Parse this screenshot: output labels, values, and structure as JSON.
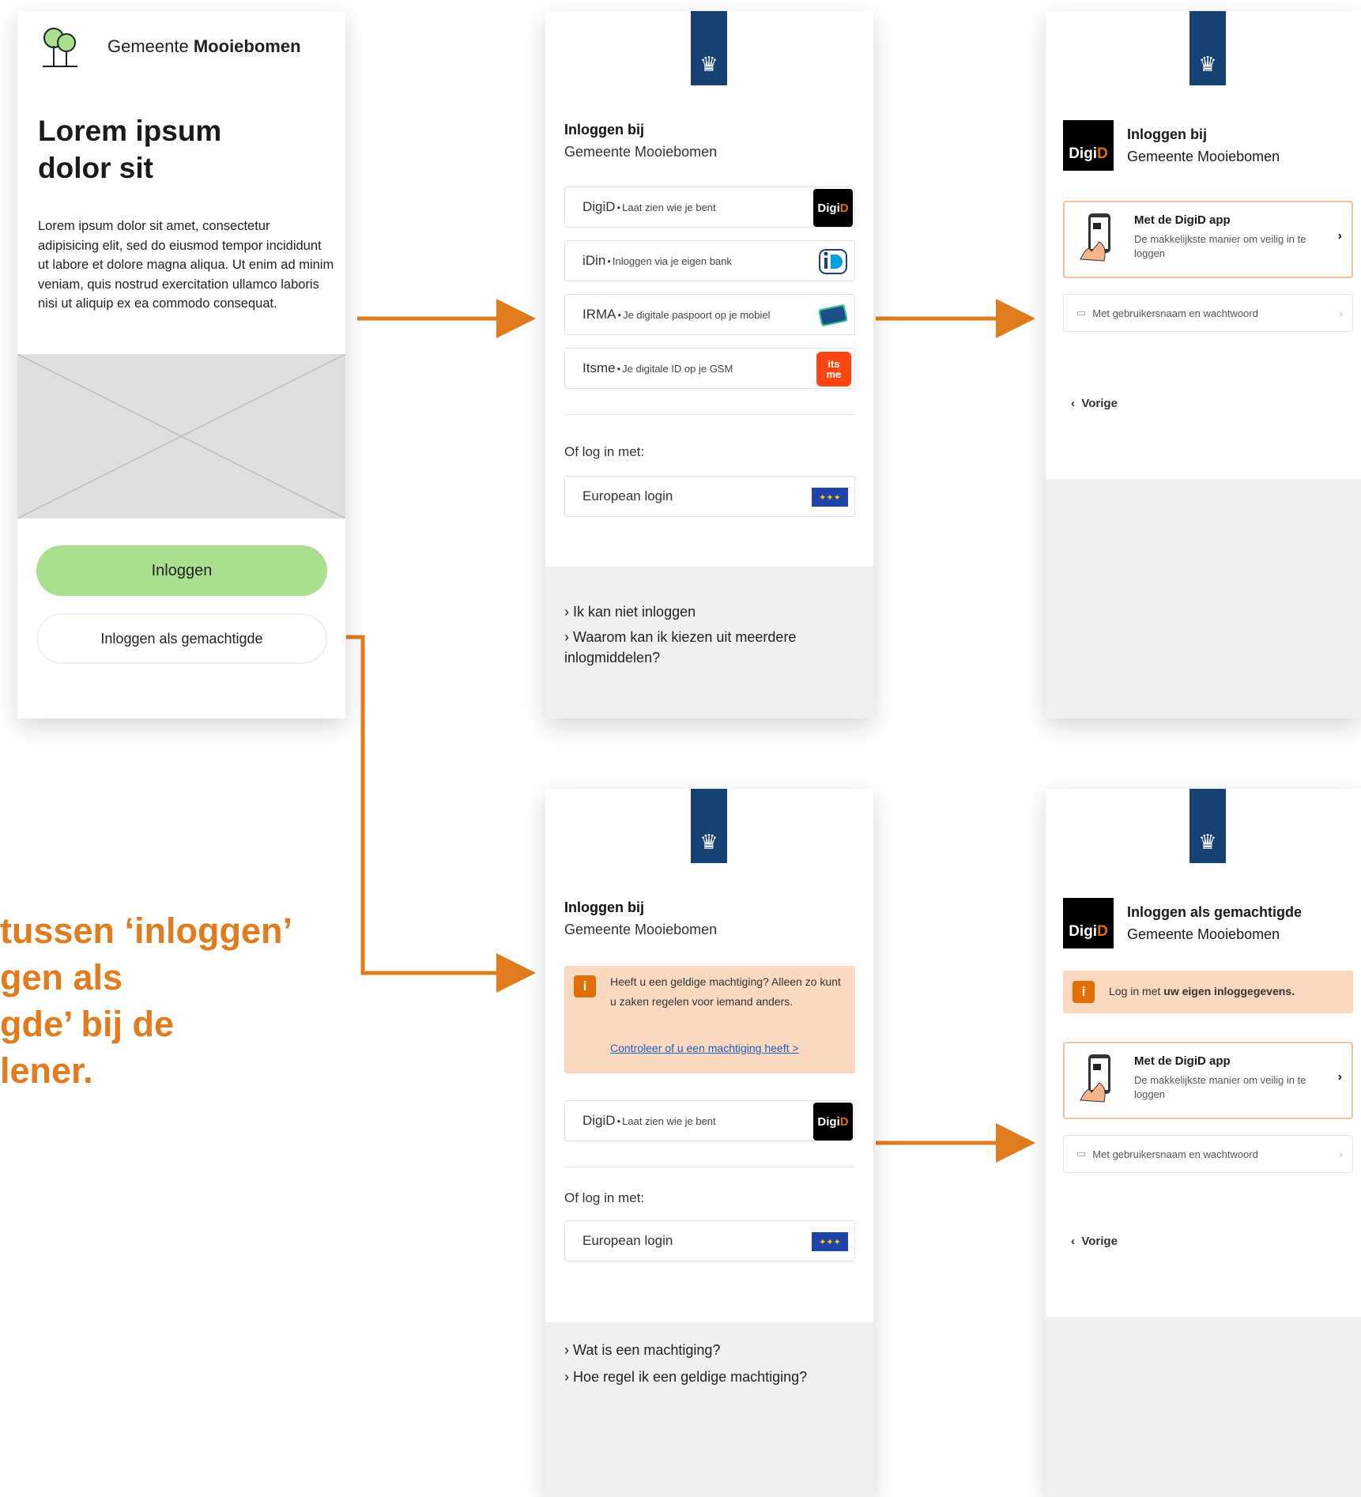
{
  "screen_gemeente": {
    "brand_prefix": "Gemeente",
    "brand_name": "Mooiebomen",
    "title": "Lorem ipsum dolor sit",
    "body": "Lorem ipsum dolor sit amet, consectetur adipisicing elit, sed do eiusmod tempor incididunt ut labore et dolore magna aliqua. Ut enim ad minim veniam, quis nostrud exercitation ullamco laboris nisi ut aliquip ex ea commodo consequat.",
    "btn_login": "Inloggen",
    "btn_gemachtigde": "Inloggen als gemachtigde"
  },
  "screen_login": {
    "title": "Inloggen bij",
    "subtitle": "Gemeente Mooiebomen",
    "options": [
      {
        "name": "DigiD",
        "desc": "Laat zien wie je bent",
        "logo": "DigiD"
      },
      {
        "name": "iDin",
        "desc": "Inloggen via je eigen bank",
        "logo": "iD"
      },
      {
        "name": "IRMA",
        "desc": "Je digitale paspoort op je mobiel",
        "logo": "IRMA"
      },
      {
        "name": "Itsme",
        "desc": "Je digitale ID op je GSM",
        "logo": "its me"
      }
    ],
    "or_label": "Of log in met:",
    "european": "European login",
    "faq": [
      "Ik kan niet inloggen",
      "Waarom kan ik kiezen uit meerdere inlogmiddelen?"
    ]
  },
  "screen_digid": {
    "title": "Inloggen bij",
    "subtitle": "Gemeente Mooiebomen",
    "app_title": "Met de DigiD app",
    "app_sub": "De makkelijkste manier om veilig in te loggen",
    "pw": "Met gebruikersnaam en wachtwoord",
    "back": "Vorige"
  },
  "screen_machtiging": {
    "title": "Inloggen bij",
    "subtitle": "Gemeente Mooiebomen",
    "notice": "Heeft u een geldige machtiging? Alleen zo kunt u zaken regelen voor iemand anders.",
    "notice_link": "Controleer of u een machtiging heeft >",
    "option": {
      "name": "DigiD",
      "desc": "Laat zien wie je bent"
    },
    "or_label": "Of log in met:",
    "european": "European login",
    "faq": [
      "Wat is een machtiging?",
      "Hoe regel ik een geldige machtiging?"
    ]
  },
  "screen_digid_gemachtigde": {
    "title": "Inloggen als gemachtigde",
    "subtitle": "Gemeente Mooiebomen",
    "notice_pre": "Log in met",
    "notice_bold": "uw eigen inloggegevens.",
    "app_title": "Met de DigiD app",
    "app_sub": "De makkelijkste manier om veilig in te loggen",
    "pw": "Met gebruikersnaam en wachtwoord",
    "back": "Vorige"
  },
  "annotation": "tussen ‘inloggen’\ngen als\ngde’ bij de\nlener.",
  "colors": {
    "arrow": "#e07b1e",
    "rijks": "#154273",
    "green": "#a9df8f",
    "notice": "#fbd8c0"
  }
}
